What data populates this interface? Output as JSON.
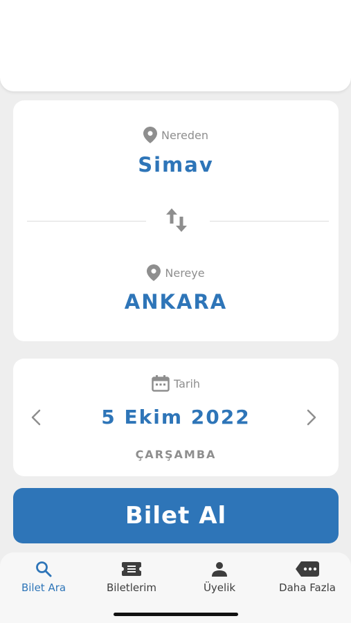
{
  "route": {
    "from_label": "Nereden",
    "from_city": "Simav",
    "to_label": "Nereye",
    "to_city": "ANKARA",
    "swap_icon": "swap-vertical-icon"
  },
  "date": {
    "label": "Tarih",
    "value": "5 Ekim 2022",
    "weekday": "ÇARŞAMBA"
  },
  "actions": {
    "buy_label": "Bilet Al"
  },
  "tabs": [
    {
      "label": "Bilet Ara",
      "icon": "search-icon",
      "active": true
    },
    {
      "label": "Biletlerim",
      "icon": "ticket-icon",
      "active": false
    },
    {
      "label": "Üyelik",
      "icon": "person-icon",
      "active": false
    },
    {
      "label": "Daha Fazla",
      "icon": "more-icon",
      "active": false
    }
  ],
  "colors": {
    "accent": "#2e75b8",
    "muted": "#8e8e8e",
    "background": "#eeeeee"
  }
}
